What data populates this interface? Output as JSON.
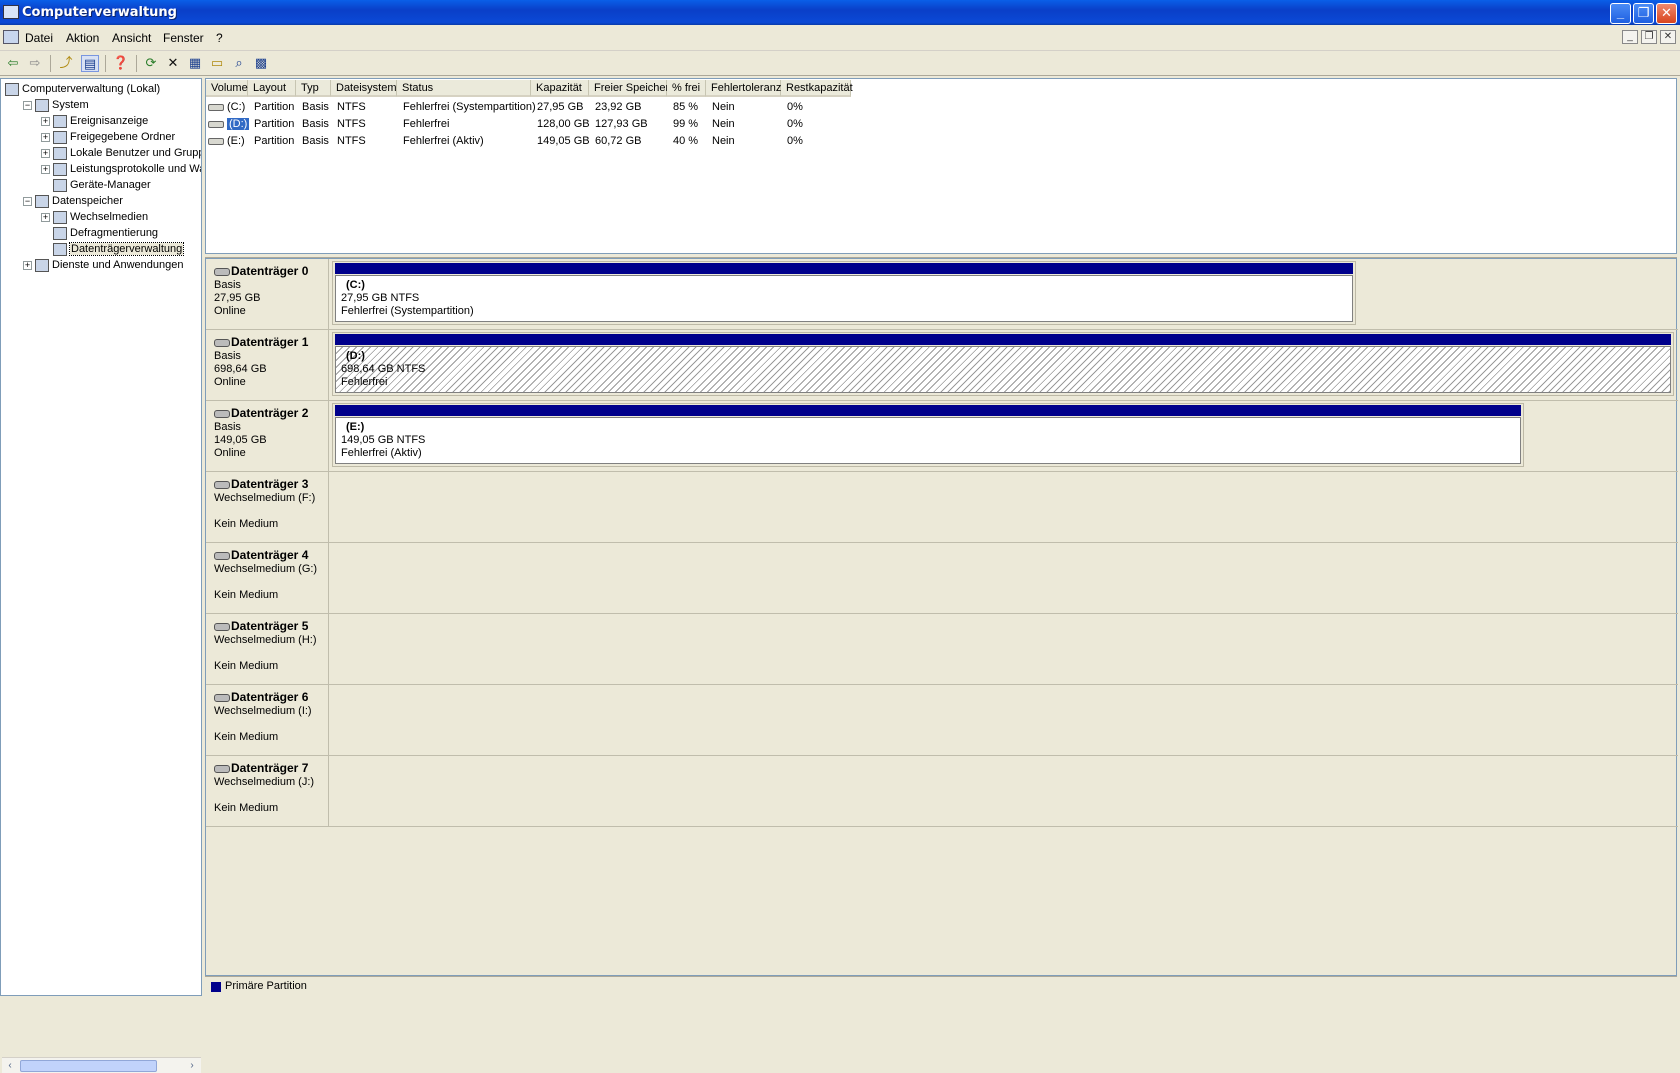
{
  "window": {
    "title": "Computerverwaltung"
  },
  "menu": {
    "items": [
      "Datei",
      "Aktion",
      "Ansicht",
      "Fenster",
      "?"
    ]
  },
  "tree": {
    "nodes": [
      {
        "label": "Computerverwaltung (Lokal)",
        "level": 0,
        "expander": "",
        "icon": "computer-icon"
      },
      {
        "label": "System",
        "level": 1,
        "expander": "−",
        "icon": "system-tools-icon"
      },
      {
        "label": "Ereignisanzeige",
        "level": 2,
        "expander": "+",
        "icon": "event-viewer-icon"
      },
      {
        "label": "Freigegebene Ordner",
        "level": 2,
        "expander": "+",
        "icon": "shared-folder-icon"
      },
      {
        "label": "Lokale Benutzer und Gruppen",
        "level": 2,
        "expander": "+",
        "icon": "users-icon"
      },
      {
        "label": "Leistungsprotokolle und Warn",
        "level": 2,
        "expander": "+",
        "icon": "performance-icon"
      },
      {
        "label": "Geräte-Manager",
        "level": 2,
        "expander": "",
        "icon": "device-manager-icon"
      },
      {
        "label": "Datenspeicher",
        "level": 1,
        "expander": "−",
        "icon": "storage-icon"
      },
      {
        "label": "Wechselmedien",
        "level": 2,
        "expander": "+",
        "icon": "removable-media-icon"
      },
      {
        "label": "Defragmentierung",
        "level": 2,
        "expander": "",
        "icon": "defrag-icon"
      },
      {
        "label": "Datenträgerverwaltung",
        "level": 2,
        "expander": "",
        "icon": "disk-management-icon",
        "selected": true
      },
      {
        "label": "Dienste und Anwendungen",
        "level": 1,
        "expander": "+",
        "icon": "services-icon"
      }
    ]
  },
  "volumes": {
    "columns": [
      "Volume",
      "Layout",
      "Typ",
      "Dateisystem",
      "Status",
      "Kapazität",
      "Freier Speicher",
      "% frei",
      "Fehlertoleranz",
      "Restkapazität"
    ],
    "rows": [
      [
        "(C:)",
        "Partition",
        "Basis",
        "NTFS",
        "Fehlerfrei (Systempartition)",
        "27,95 GB",
        "23,92 GB",
        "85 %",
        "Nein",
        "0%"
      ],
      [
        "(D:)",
        "Partition",
        "Basis",
        "NTFS",
        "Fehlerfrei",
        "128,00 GB",
        "127,93 GB",
        "99 %",
        "Nein",
        "0%"
      ],
      [
        "(E:)",
        "Partition",
        "Basis",
        "NTFS",
        "Fehlerfrei (Aktiv)",
        "149,05 GB",
        "60,72 GB",
        "40 %",
        "Nein",
        "0%"
      ]
    ],
    "selected_row": 1
  },
  "disks": [
    {
      "name": "Datenträger 0",
      "l1": "Basis",
      "l2": "27,95 GB",
      "l3": "Online",
      "partition": {
        "name": "(C:)",
        "size": "27,95 GB NTFS",
        "status": "Fehlerfrei (Systempartition)",
        "hatched": false,
        "width_fraction": 0.763
      }
    },
    {
      "name": "Datenträger 1",
      "l1": "Basis",
      "l2": "698,64 GB",
      "l3": "Online",
      "partition": {
        "name": "(D:)",
        "size": "698,64 GB NTFS",
        "status": "Fehlerfrei",
        "hatched": true,
        "width_fraction": 1.0
      }
    },
    {
      "name": "Datenträger 2",
      "l1": "Basis",
      "l2": "149,05 GB",
      "l3": "Online",
      "partition": {
        "name": "(E:)",
        "size": "149,05 GB NTFS",
        "status": "Fehlerfrei (Aktiv)",
        "hatched": false,
        "width_fraction": 0.888
      }
    },
    {
      "name": "Datenträger 3",
      "l1": "Wechselmedium (F:)",
      "l2": "",
      "l3": "Kein Medium",
      "partition": null
    },
    {
      "name": "Datenträger 4",
      "l1": "Wechselmedium (G:)",
      "l2": "",
      "l3": "Kein Medium",
      "partition": null
    },
    {
      "name": "Datenträger 5",
      "l1": "Wechselmedium (H:)",
      "l2": "",
      "l3": "Kein Medium",
      "partition": null
    },
    {
      "name": "Datenträger 6",
      "l1": "Wechselmedium (I:)",
      "l2": "",
      "l3": "Kein Medium",
      "partition": null
    },
    {
      "name": "Datenträger 7",
      "l1": "Wechselmedium (J:)",
      "l2": "",
      "l3": "Kein Medium",
      "partition": null
    }
  ],
  "legend": {
    "primary_label": "Primäre Partition",
    "primary_color": "#00008b"
  },
  "colors": {
    "accent_titlebar": "#0a5fe8",
    "selection": "#316ac5",
    "partition_bar": "#00008b"
  }
}
